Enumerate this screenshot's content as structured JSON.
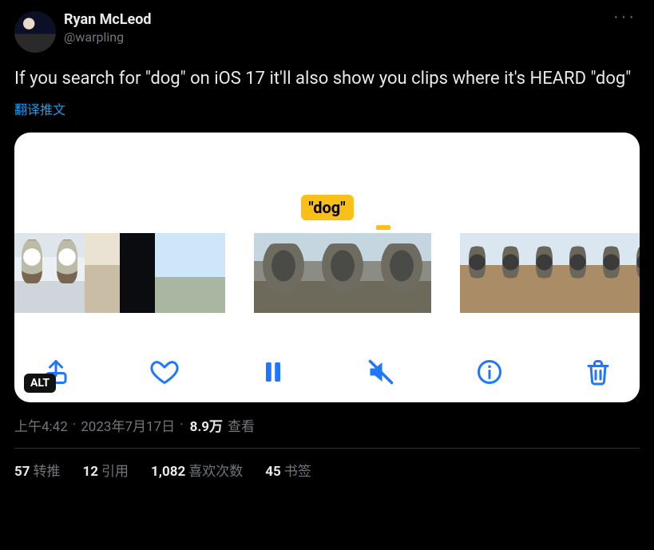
{
  "author": {
    "display_name": "Ryan McLeod",
    "handle": "@warpling"
  },
  "more_label": "···",
  "tweet_text": "If you search for \"dog\" on iOS 17 it'll also show you clips where it's HEARD \"dog\"",
  "translate_label": "翻译推文",
  "media": {
    "caption_text": "\"dog\"",
    "alt_badge": "ALT",
    "toolbar": {
      "share": "share",
      "like": "like",
      "pause": "pause",
      "mute": "mute",
      "info": "info",
      "delete": "delete"
    }
  },
  "meta": {
    "time": "上午4:42",
    "dot1": "·",
    "date": "2023年7月17日",
    "dot2": "·",
    "views_count": "8.9万",
    "views_label": "查看"
  },
  "stats": {
    "retweets": {
      "count": "57",
      "label": "转推"
    },
    "quotes": {
      "count": "12",
      "label": "引用"
    },
    "likes": {
      "count": "1,082",
      "label": "喜欢次数"
    },
    "bookmarks": {
      "count": "45",
      "label": "书签"
    }
  }
}
